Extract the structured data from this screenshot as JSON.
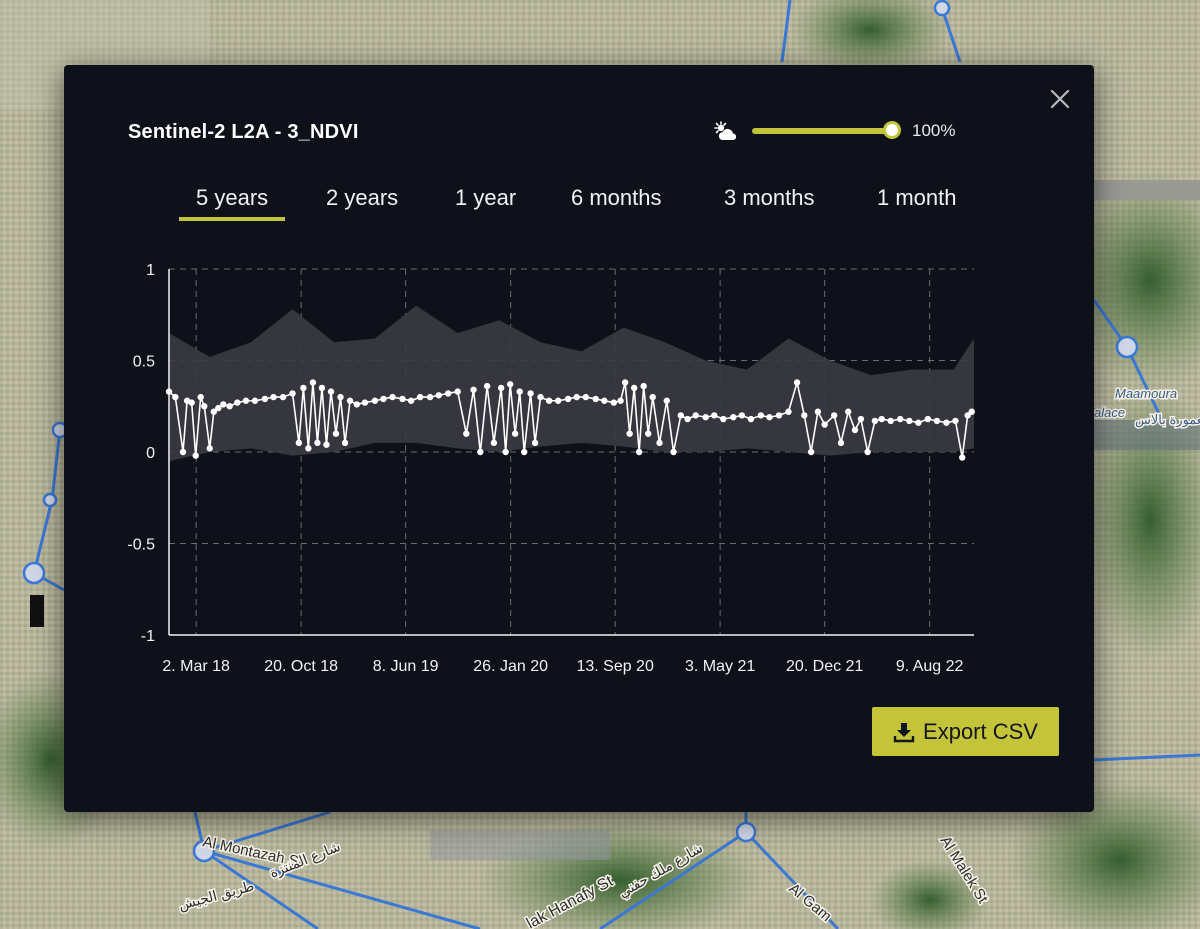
{
  "map": {
    "labels": [
      "Maamoura",
      "alace",
      "معمورة بالاس",
      "Al Montazah St",
      "شارع المنتزة",
      "طريق الجيش",
      "شارع ملك حفني",
      "lak Hanafy St",
      "Al Gam",
      "Al Malek St"
    ]
  },
  "modal": {
    "title": "Sentinel-2 L2A - 3_NDVI",
    "close_icon": "close-icon",
    "cloud_icon": "cloud-sun-icon",
    "cloud_coverage_value": 1.0,
    "cloud_coverage_label": "100%",
    "tabs": [
      {
        "label": "5 years",
        "active": true
      },
      {
        "label": "2 years",
        "active": false
      },
      {
        "label": "1 year",
        "active": false
      },
      {
        "label": "6 months",
        "active": false
      },
      {
        "label": "3 months",
        "active": false
      },
      {
        "label": "1 month",
        "active": false
      }
    ],
    "export_label": "Export CSV",
    "export_icon": "download-icon",
    "colors": {
      "accent": "#c3c43a",
      "background": "#0f111a",
      "band": "#3a3b42",
      "line": "#ffffff"
    }
  },
  "chart_data": {
    "type": "line",
    "ylim": [
      -1,
      1
    ],
    "yticks": [
      1,
      0.5,
      0,
      -0.5,
      -1
    ],
    "ytick_labels": [
      "1",
      "0.5",
      "0",
      "-0.5",
      "-1"
    ],
    "xlim": [
      "2018-01-01",
      "2022-11-15"
    ],
    "xticks": [
      "2018-03-02",
      "2018-10-20",
      "2019-06-08",
      "2020-01-26",
      "2020-09-13",
      "2021-05-03",
      "2021-12-20",
      "2022-08-09"
    ],
    "xtick_labels": [
      "2. Mar 18",
      "20. Oct 18",
      "8. Jun 19",
      "26. Jan 20",
      "13. Sep 20",
      "3. May 21",
      "20. Dec 21",
      "9. Aug 22"
    ],
    "grid": true,
    "series": [
      {
        "type": "band",
        "x": [
          "2018-01-01",
          "2018-04-01",
          "2018-07-01",
          "2018-10-01",
          "2019-01-01",
          "2019-04-01",
          "2019-07-01",
          "2019-10-01",
          "2020-01-01",
          "2020-04-01",
          "2020-07-01",
          "2020-10-01",
          "2021-01-01",
          "2021-04-01",
          "2021-07-01",
          "2021-10-01",
          "2022-01-01",
          "2022-04-01",
          "2022-07-01",
          "2022-10-01",
          "2022-11-15"
        ],
        "low": [
          -0.05,
          0.0,
          0.02,
          -0.02,
          0.0,
          0.05,
          0.05,
          0.02,
          0.0,
          0.03,
          0.05,
          0.03,
          0.0,
          0.0,
          0.02,
          0.0,
          -0.02,
          0.0,
          0.0,
          0.0,
          0.02
        ],
        "high": [
          0.65,
          0.52,
          0.6,
          0.78,
          0.6,
          0.62,
          0.8,
          0.65,
          0.72,
          0.6,
          0.55,
          0.68,
          0.6,
          0.5,
          0.45,
          0.62,
          0.5,
          0.42,
          0.45,
          0.45,
          0.62
        ]
      },
      {
        "type": "line",
        "x": [
          "2018-01-01",
          "2018-01-15",
          "2018-02-01",
          "2018-02-10",
          "2018-02-20",
          "2018-03-01",
          "2018-03-12",
          "2018-03-20",
          "2018-04-01",
          "2018-04-10",
          "2018-04-20",
          "2018-05-01",
          "2018-05-15",
          "2018-06-01",
          "2018-06-20",
          "2018-07-10",
          "2018-08-01",
          "2018-08-20",
          "2018-09-10",
          "2018-10-01",
          "2018-10-15",
          "2018-10-25",
          "2018-11-05",
          "2018-11-15",
          "2018-11-25",
          "2018-12-05",
          "2018-12-15",
          "2018-12-25",
          "2019-01-05",
          "2019-01-15",
          "2019-01-25",
          "2019-02-05",
          "2019-02-20",
          "2019-03-10",
          "2019-04-01",
          "2019-04-20",
          "2019-05-10",
          "2019-06-01",
          "2019-06-20",
          "2019-07-10",
          "2019-08-01",
          "2019-08-20",
          "2019-09-10",
          "2019-10-01",
          "2019-10-20",
          "2019-11-05",
          "2019-11-20",
          "2019-12-05",
          "2019-12-20",
          "2020-01-05",
          "2020-01-15",
          "2020-01-25",
          "2020-02-05",
          "2020-02-15",
          "2020-02-25",
          "2020-03-10",
          "2020-03-20",
          "2020-04-01",
          "2020-04-20",
          "2020-05-10",
          "2020-06-01",
          "2020-06-20",
          "2020-07-10",
          "2020-08-01",
          "2020-08-20",
          "2020-09-10",
          "2020-09-25",
          "2020-10-05",
          "2020-10-15",
          "2020-10-25",
          "2020-11-05",
          "2020-11-15",
          "2020-11-25",
          "2020-12-05",
          "2020-12-20",
          "2021-01-05",
          "2021-01-20",
          "2021-02-05",
          "2021-02-20",
          "2021-03-10",
          "2021-04-01",
          "2021-04-20",
          "2021-05-10",
          "2021-06-01",
          "2021-06-20",
          "2021-07-10",
          "2021-08-01",
          "2021-08-20",
          "2021-09-10",
          "2021-10-01",
          "2021-10-20",
          "2021-11-05",
          "2021-11-20",
          "2021-12-05",
          "2021-12-20",
          "2022-01-10",
          "2022-01-25",
          "2022-02-10",
          "2022-02-25",
          "2022-03-10",
          "2022-03-25",
          "2022-04-10",
          "2022-04-25",
          "2022-05-15",
          "2022-06-05",
          "2022-06-25",
          "2022-07-15",
          "2022-08-05",
          "2022-08-25",
          "2022-09-15",
          "2022-10-05",
          "2022-10-20",
          "2022-11-01",
          "2022-11-10"
        ],
        "y": [
          0.33,
          0.3,
          0.0,
          0.28,
          0.27,
          -0.02,
          0.3,
          0.25,
          0.02,
          0.22,
          0.24,
          0.26,
          0.25,
          0.27,
          0.28,
          0.28,
          0.29,
          0.3,
          0.3,
          0.32,
          0.05,
          0.35,
          0.02,
          0.38,
          0.05,
          0.35,
          0.04,
          0.33,
          0.1,
          0.3,
          0.05,
          0.28,
          0.26,
          0.27,
          0.28,
          0.29,
          0.3,
          0.29,
          0.28,
          0.3,
          0.3,
          0.31,
          0.32,
          0.33,
          0.1,
          0.34,
          0.0,
          0.36,
          0.05,
          0.35,
          0.0,
          0.37,
          0.1,
          0.33,
          0.0,
          0.32,
          0.05,
          0.3,
          0.28,
          0.28,
          0.29,
          0.3,
          0.3,
          0.29,
          0.28,
          0.27,
          0.28,
          0.38,
          0.1,
          0.35,
          0.0,
          0.36,
          0.1,
          0.3,
          0.05,
          0.28,
          0.0,
          0.2,
          0.18,
          0.2,
          0.19,
          0.2,
          0.18,
          0.19,
          0.2,
          0.18,
          0.2,
          0.19,
          0.2,
          0.22,
          0.38,
          0.2,
          0.0,
          0.22,
          0.15,
          0.2,
          0.05,
          0.22,
          0.12,
          0.18,
          0.0,
          0.17,
          0.18,
          0.17,
          0.18,
          0.17,
          0.16,
          0.18,
          0.17,
          0.16,
          0.17,
          -0.03,
          0.2,
          0.22
        ]
      }
    ]
  }
}
